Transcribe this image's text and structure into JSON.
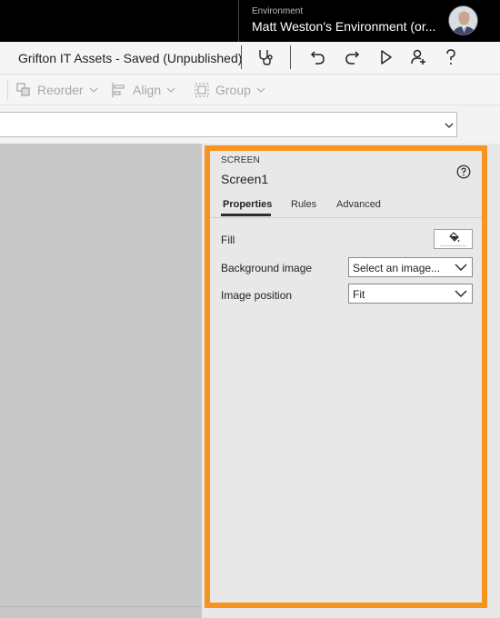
{
  "header": {
    "environment_label": "Environment",
    "environment_name": "Matt Weston's Environment (or..."
  },
  "titlebar": {
    "app_title": "Grifton IT Assets - Saved (Unpublished)"
  },
  "toolbar": {
    "reorder_label": "Reorder",
    "align_label": "Align",
    "group_label": "Group"
  },
  "formula": {
    "value": ""
  },
  "panel": {
    "kicker": "SCREEN",
    "title": "Screen1",
    "tabs": [
      {
        "label": "Properties",
        "active": true
      },
      {
        "label": "Rules",
        "active": false
      },
      {
        "label": "Advanced",
        "active": false
      }
    ],
    "properties": {
      "fill_label": "Fill",
      "background_image_label": "Background image",
      "background_image_value": "Select an image...",
      "image_position_label": "Image position",
      "image_position_value": "Fit"
    },
    "highlight_color": "#f7941d"
  }
}
